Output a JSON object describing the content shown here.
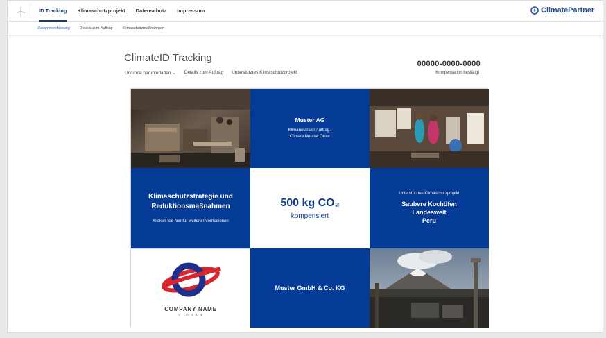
{
  "nav": {
    "items": [
      {
        "label": "ID Tracking",
        "active": true
      },
      {
        "label": "Klimaschutzprojekt",
        "active": false
      },
      {
        "label": "Datenschutz",
        "active": false
      },
      {
        "label": "Impressum",
        "active": false
      }
    ]
  },
  "brand": {
    "name": "ClimatePartner",
    "color": "#2b4f91"
  },
  "subnav": {
    "items": [
      {
        "label": "Zusammenfassung",
        "active": true
      },
      {
        "label": "Details zum Auftrag",
        "active": false
      },
      {
        "label": "Klimaschutzmaßnahmen",
        "active": false
      }
    ]
  },
  "page": {
    "title": "ClimateID Tracking",
    "links": {
      "download": "Urkunde herunterladen ⌄",
      "details": "Details zum Auftrag",
      "project": "Unterstütztes Klimaschutzprojekt"
    },
    "id_number": "00000-0000-0000",
    "status": "Kompensation bestätigt"
  },
  "tiles": {
    "photo_kitchen": {
      "icon": "photo-traditional-kitchen"
    },
    "company": {
      "name": "Muster AG",
      "line1": "Klimaneutraler Auftrag /",
      "line2": "Climate Neutral Order"
    },
    "photo_people": {
      "icon": "photo-people-cooking"
    },
    "strategy": {
      "line1": "Klimaschutzstrategie und",
      "line2": "Reduktionsmaßnahmen",
      "sub": "Klicken Sie hier für weitere Informationen"
    },
    "co2": {
      "value": "500 kg CO₂",
      "label": "kompensiert"
    },
    "project": {
      "small": "Unterstütztes Klimaschutzprojekt",
      "line1": "Saubere Kochöfen",
      "line2": "Landesweit",
      "line3": "Peru"
    },
    "logo": {
      "company": "COMPANY NAME",
      "slogan": "SLOGAN",
      "icon": "company-logo-icon"
    },
    "gmbh": {
      "name": "Muster GmbH & Co. KG"
    },
    "photo_volcano": {
      "icon": "photo-volcano-landscape"
    }
  },
  "colors": {
    "tile_blue": "#043b96",
    "accent_blue": "#2b6bd6",
    "logo_red": "#d8262e",
    "logo_navy": "#1e2f8c"
  }
}
